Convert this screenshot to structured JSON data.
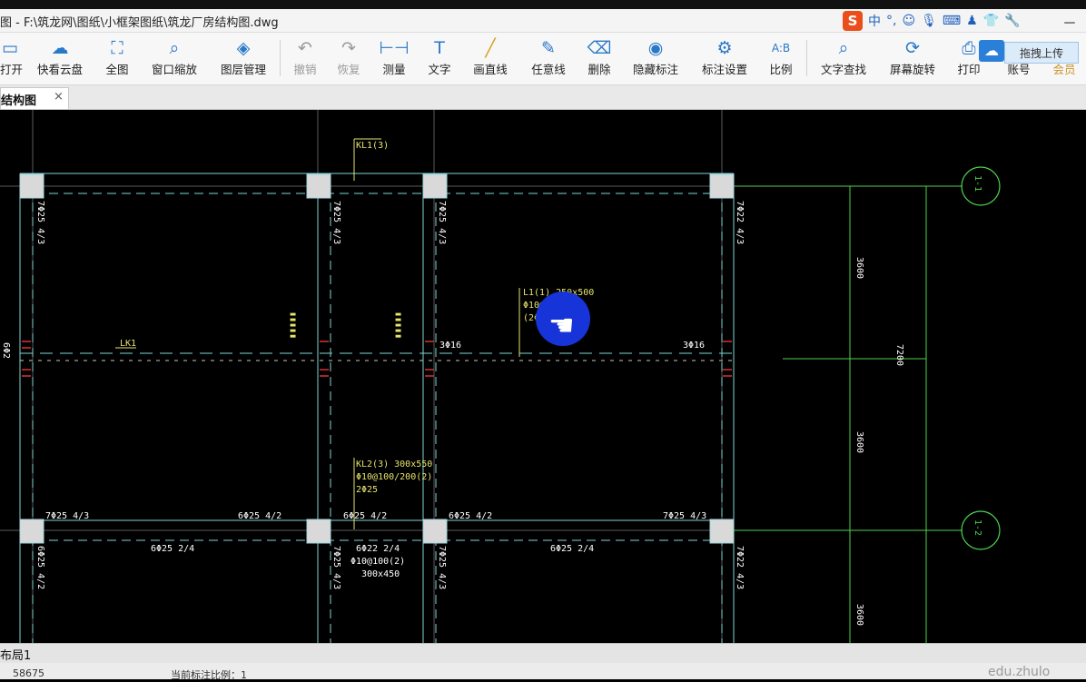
{
  "window": {
    "title": "图 - F:\\筑龙网\\图纸\\小框架图纸\\筑龙厂房结构图.dwg",
    "minimize": "－"
  },
  "ime": {
    "logo": "S",
    "lang": "中",
    "punct": "°,"
  },
  "toolbar": {
    "open": "打开",
    "cloud_disk": "快看云盘",
    "full_view": "全图",
    "window_zoom": "窗口缩放",
    "layer_manage": "图层管理",
    "undo": "撤销",
    "redo": "恢复",
    "measure": "测量",
    "text": "文字",
    "draw_line": "画直线",
    "freehand_line": "任意线",
    "delete": "删除",
    "hide_annotation": "隐藏标注",
    "annotation_settings": "标注设置",
    "scale": "比例",
    "text_search": "文字查找",
    "screen_rotate": "屏幕旋转",
    "print": "打印",
    "account": "账号",
    "vip": "会员",
    "upload": "拖拽上传"
  },
  "tabs": {
    "active_label": "结构图",
    "close": "×"
  },
  "drawing": {
    "labels": {
      "kl1": "KL1(3)",
      "l1_a": "L1(1) 250x500",
      "l1_b": "Φ10@200(2)",
      "l1_c": "(2Φ14);6Φ",
      "lk1": "LK1",
      "kl2_a": "KL2(3) 300x550",
      "kl2_b": "Φ10@100/200(2)",
      "kl2_c": "2Φ25",
      "b3_16_left": "3Φ16",
      "b3_16_right": "3Φ16",
      "bot_1": "7Φ25 4/3",
      "bot_2": "6Φ25 4/2",
      "bot_3": "6Φ25 4/2",
      "bot_4": "6Φ25 4/2",
      "bot_5": "7Φ25 4/3",
      "bot_6": "6Φ25 2/4",
      "bot_7": "6Φ22 2/4",
      "bot_8": "Φ10@100(2)",
      "bot_9": "300x450",
      "bot_10": "6Φ25 2/4",
      "v_1": "7Φ25 4/3",
      "v_2": "7Φ25 4/3",
      "v_3": "7Φ25 4/3",
      "v_4": "7Φ22 4/3",
      "v_5": "6Φ25 4/2",
      "v_6": "7Φ25 4/3",
      "v_7": "7Φ25 4/3",
      "v_8": "7Φ22 4/3",
      "side_left": "6Φ2"
    },
    "dims": {
      "d1": "3600",
      "d2": "7200",
      "d3": "3600",
      "d4": "3600"
    },
    "axes": {
      "a1": "1-1",
      "a2": "1-2"
    }
  },
  "layout_tab": "布局1",
  "status": {
    "coord": "58675",
    "scale_label": "当前标注比例：1"
  },
  "watermark": "edu.zhulo"
}
